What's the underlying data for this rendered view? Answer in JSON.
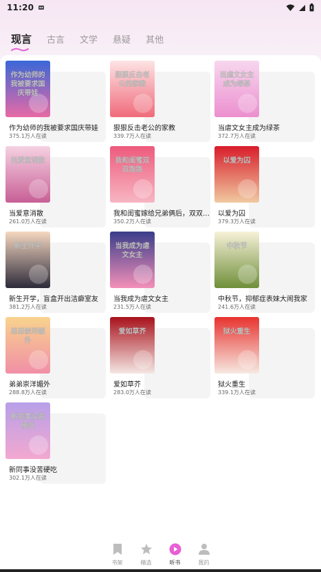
{
  "status_bar": {
    "time": "11:20",
    "icons": [
      "notification-icon",
      "wifi-icon",
      "signal-icon",
      "battery-icon"
    ]
  },
  "tabs": [
    {
      "label": "现言",
      "active": true
    },
    {
      "label": "古言",
      "active": false
    },
    {
      "label": "文学",
      "active": false
    },
    {
      "label": "悬疑",
      "active": false
    },
    {
      "label": "其他",
      "active": false
    }
  ],
  "books": [
    {
      "title": "作为幼师的我被要求国庆带娃",
      "readers": "375.1万人在读",
      "cover_text": "作为幼师的我被要求国庆带娃",
      "cover_colors": [
        "#3a67d8",
        "#e86aa5"
      ]
    },
    {
      "title": "狠狠反击老公的家教",
      "readers": "339.7万人在读",
      "cover_text": "狠狠反击老公的家教",
      "cover_colors": [
        "#fde3e4",
        "#f06b7b"
      ]
    },
    {
      "title": "当虐文女主成为绿茶",
      "readers": "372.7万人在读",
      "cover_text": "当虐文女主成为绿茶",
      "cover_colors": [
        "#f7d7ee",
        "#ec8fcf"
      ]
    },
    {
      "title": "当爱意消散",
      "readers": "261.0万人在读",
      "cover_text": "当爱意消散",
      "cover_colors": [
        "#f6d2e3",
        "#c75f95"
      ]
    },
    {
      "title": "我和闺蜜嫁给兄弟俩后，双双跑路",
      "readers": "350.2万人在读",
      "cover_text": "我和闺蜜双双跑路",
      "cover_colors": [
        "#ee5a7c",
        "#f7b6c3"
      ]
    },
    {
      "title": "以爱为囚",
      "readers": "379.3万人在读",
      "cover_text": "以爱为囚",
      "cover_colors": [
        "#d81c2a",
        "#f0c9a0"
      ]
    },
    {
      "title": "新生开学，盲盒开出洁癖室友",
      "readers": "381.2万人在读",
      "cover_text": "新生开学",
      "cover_colors": [
        "#f5d7c0",
        "#2d2b3a"
      ]
    },
    {
      "title": "当我成为虐文女主",
      "readers": "231.5万人在读",
      "cover_text": "当我成为虐文女主",
      "cover_colors": [
        "#3a3d8a",
        "#f390b8"
      ]
    },
    {
      "title": "中秋节，抑郁症表妹大闹我家",
      "readers": "241.6万人在读",
      "cover_text": "中秋节",
      "cover_colors": [
        "#f7f1d8",
        "#6f8f3a"
      ]
    },
    {
      "title": "弟弟崇洋媚外",
      "readers": "288.8万人在读",
      "cover_text": "弟弟崇洋媚外",
      "cover_colors": [
        "#f9d38e",
        "#f08fa6"
      ]
    },
    {
      "title": "爱如草芥",
      "readers": "283.0万人在读",
      "cover_text": "爱如草芥",
      "cover_colors": [
        "#a8121c",
        "#f4e6e3"
      ]
    },
    {
      "title": "狱火重生",
      "readers": "339.1万人在读",
      "cover_text": "狱火重生",
      "cover_colors": [
        "#e8332f",
        "#f6e9e1"
      ]
    },
    {
      "title": "新同事没苦硬吃",
      "readers": "302.1万人在读",
      "cover_text": "新同事没苦硬吃",
      "cover_colors": [
        "#b7a0e8",
        "#f3a8d0"
      ]
    }
  ],
  "bottom_nav": [
    {
      "label": "书架",
      "icon": "bookmark-icon",
      "active": false
    },
    {
      "label": "精选",
      "icon": "star-icon",
      "active": false
    },
    {
      "label": "听书",
      "icon": "play-icon",
      "active": true
    },
    {
      "label": "我的",
      "icon": "person-icon",
      "active": false
    }
  ],
  "colors": {
    "accent": "#e85fd5",
    "tab_active": "#222222",
    "tab_inactive": "#9a9a9a",
    "reader_text": "#666666"
  }
}
